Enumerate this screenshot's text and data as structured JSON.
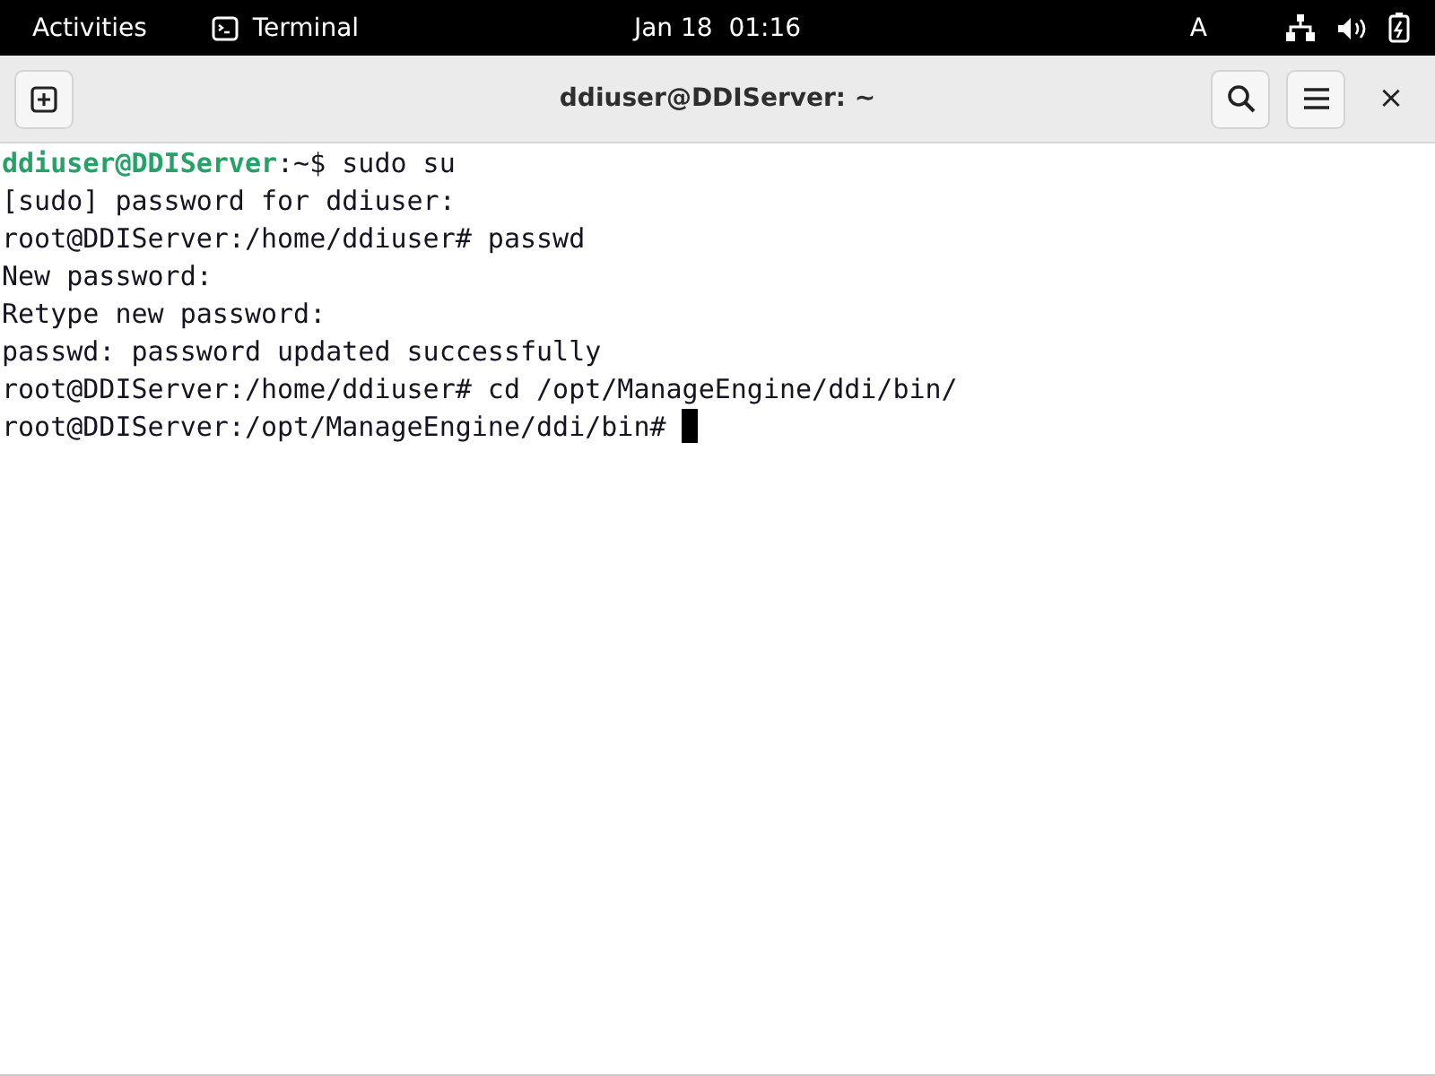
{
  "top_bar": {
    "activities": "Activities",
    "app": "Terminal",
    "clock": "Jan 18  01:16",
    "input_method": "A"
  },
  "window": {
    "title": "ddiuser@DDIServer: ~",
    "close": "×"
  },
  "terminal": {
    "lines": [
      {
        "prompt": "ddiuser@DDIServer",
        "text": ":~$ sudo su"
      },
      {
        "text": "[sudo] password for ddiuser:"
      },
      {
        "text": "root@DDIServer:/home/ddiuser# passwd"
      },
      {
        "text": "New password:"
      },
      {
        "text": "Retype new password:"
      },
      {
        "text": "passwd: password updated successfully"
      },
      {
        "text": "root@DDIServer:/home/ddiuser# cd /opt/ManageEngine/ddi/bin/"
      },
      {
        "text": "root@DDIServer:/opt/ManageEngine/ddi/bin# ",
        "cursor": true
      }
    ]
  }
}
